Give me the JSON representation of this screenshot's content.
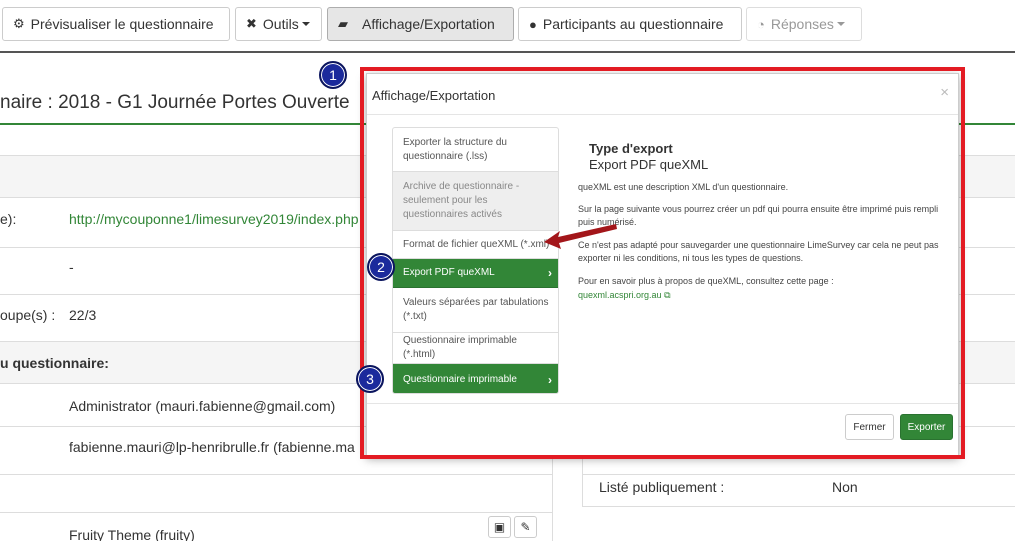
{
  "toolbar": {
    "preview": "Prévisualiser le questionnaire",
    "tools": "Outils",
    "display_export": "Affichage/Exportation",
    "participants": "Participants au questionnaire",
    "responses": "Réponses"
  },
  "page": {
    "title": "naire : 2018 - G1 Journée Portes Ouverte",
    "rows": [
      {
        "label": "e):",
        "value": "http://mycouponne1/limesurvey2019/index.php"
      },
      {
        "label": "",
        "value": "-"
      },
      {
        "label": "oupe(s) :",
        "value": "22/3"
      }
    ],
    "section": "u questionnaire:",
    "rows2": [
      {
        "label": "",
        "value": "Administrator (mauri.fabienne@gmail.com)"
      },
      {
        "label": "",
        "value": "fabienne.mauri@lp-henribrulle.fr (fabienne.ma"
      },
      {
        "label": "",
        "value": ""
      },
      {
        "label": "",
        "value": "Fruity Theme (fruity)"
      }
    ],
    "right_label": "Listé publiquement :",
    "right_value": "Non"
  },
  "modal": {
    "title": "Affichage/Exportation",
    "close_icon": "×",
    "list": [
      {
        "label": "Exporter la structure du questionnaire (.lss)",
        "state": "normal"
      },
      {
        "label": "Archive de questionnaire - seulement pour les questionnaires activés",
        "state": "disabled"
      },
      {
        "label": "Format de fichier queXML (*.xml)",
        "state": "normal"
      },
      {
        "label": "Export PDF queXML",
        "state": "selected"
      },
      {
        "label": "Valeurs séparées par tabulations (*.txt)",
        "state": "normal"
      },
      {
        "label": "Questionnaire imprimable (*.html)",
        "state": "normal"
      },
      {
        "label": "Questionnaire imprimable",
        "state": "selected"
      }
    ],
    "export_type_title": "Type d'export",
    "export_type_value": "Export PDF queXML",
    "desc1": "queXML est une description XML d'un questionnaire.",
    "desc2": "Sur la page suivante vous pourrez créer un pdf qui pourra ensuite être imprimé puis rempli puis numérisé.",
    "desc3": "Ce n'est pas adapté pour sauvegarder une questionnaire LimeSurvey car cela ne peut pas exporter ni les conditions, ni tous les types de questions.",
    "desc4": "Pour en savoir plus à propos de queXML, consultez cette page :",
    "desc_link": "quexml.acspri.org.au",
    "btn_close": "Fermer",
    "btn_export": "Exporter"
  },
  "markers": [
    "1",
    "2",
    "3"
  ],
  "colors": {
    "accent": "#328637",
    "highlight": "#e31b23",
    "marker": "#1b2a9c"
  }
}
